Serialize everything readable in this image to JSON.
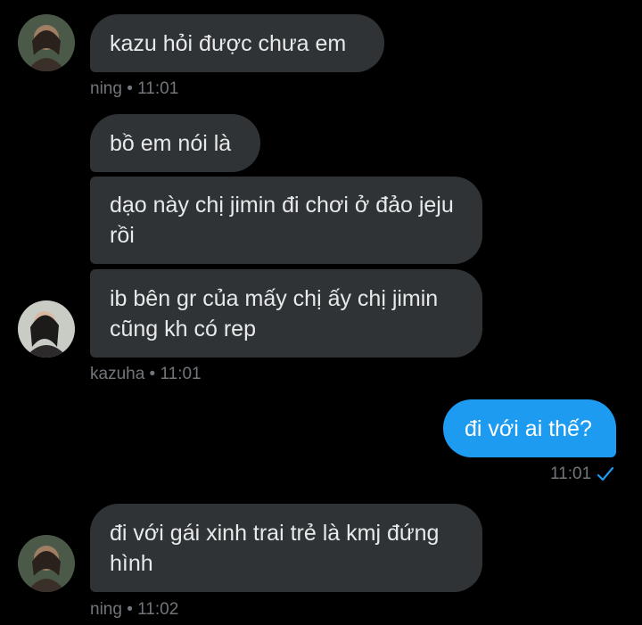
{
  "messages": [
    {
      "text": "kazu hỏi được chưa em"
    },
    {
      "text": "bồ em nói là"
    },
    {
      "text": "dạo này chị jimin đi chơi ở đảo jeju rồi"
    },
    {
      "text": "ib bên gr của mấy chị ấy chị jimin cũng kh có rep"
    },
    {
      "text": "đi với ai thế?"
    },
    {
      "text": "đi với gái xinh trai trẻ là kmj đứng hình"
    }
  ],
  "meta": {
    "m1": "ning • 11:01",
    "m2": "kazuha • 11:01",
    "m3": "11:01",
    "m4": "ning • 11:02"
  },
  "icons": {
    "read_check": "check-icon",
    "accent": "#1d9bf0"
  }
}
